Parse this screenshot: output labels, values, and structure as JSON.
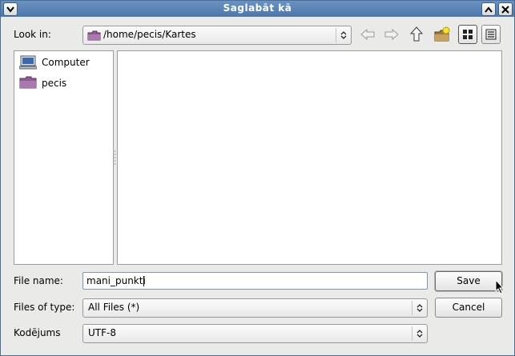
{
  "window": {
    "title": "Saglabāt kā"
  },
  "location": {
    "label": "Look in:",
    "path": "/home/pecis/Kartes"
  },
  "places": [
    {
      "label": "Computer",
      "icon": "computer-icon"
    },
    {
      "label": "pecis",
      "icon": "folder-icon"
    }
  ],
  "filename": {
    "label": "File name:",
    "value": "mani_punkti"
  },
  "filetype": {
    "label": "Files of type:",
    "value": "All Files (*)"
  },
  "encoding": {
    "label": "Kodējums",
    "value": "UTF-8"
  },
  "buttons": {
    "save": "Save",
    "cancel": "Cancel"
  },
  "colors": {
    "titlebar": "#5a82b4",
    "folder": "#8e5b94",
    "entry_border": "#7a96b8"
  }
}
